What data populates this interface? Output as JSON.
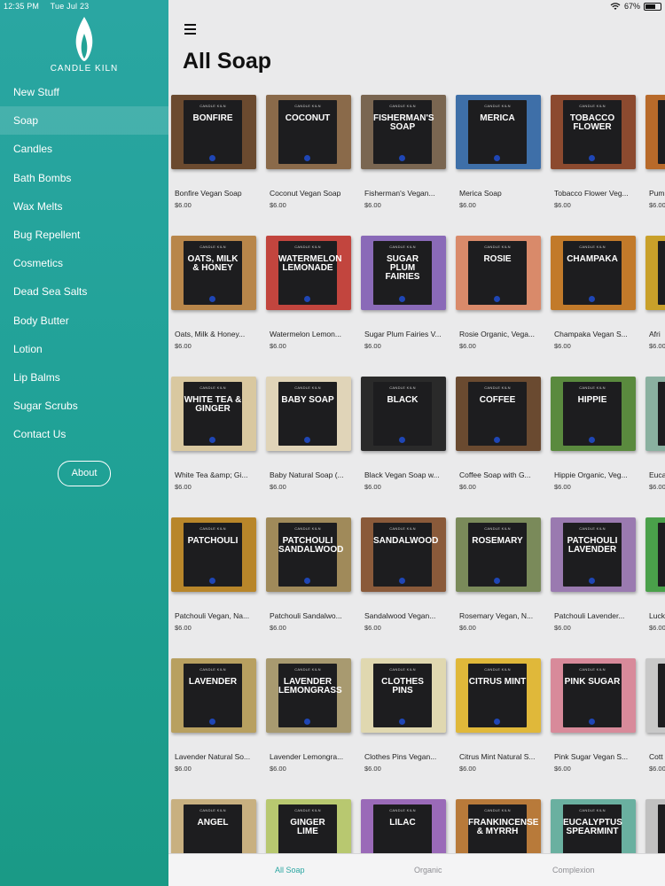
{
  "status": {
    "time": "12:35 PM",
    "date": "Tue Jul 23",
    "battery": "67%"
  },
  "brand": {
    "name": "CANDLE KILN"
  },
  "sidebar": {
    "items": [
      {
        "label": "New Stuff"
      },
      {
        "label": "Soap"
      },
      {
        "label": "Candles"
      },
      {
        "label": "Bath Bombs"
      },
      {
        "label": "Wax Melts"
      },
      {
        "label": "Bug Repellent"
      },
      {
        "label": "Cosmetics"
      },
      {
        "label": "Dead Sea Salts"
      },
      {
        "label": "Body Butter"
      },
      {
        "label": "Lotion"
      },
      {
        "label": "Lip Balms"
      },
      {
        "label": "Sugar Scrubs"
      },
      {
        "label": "Contact Us"
      }
    ],
    "active_index": 1,
    "about_label": "About"
  },
  "main": {
    "title": "All Soap"
  },
  "products": [
    {
      "title": "BONFIRE",
      "name": "Bonfire Vegan Soap",
      "price": "$6.00",
      "color": "#6b4a2f"
    },
    {
      "title": "COCONUT",
      "name": "Coconut Vegan Soap",
      "price": "$6.00",
      "color": "#8a6a4a"
    },
    {
      "title": "FISHERMAN'S SOAP",
      "name": "Fisherman's Vegan...",
      "price": "$6.00",
      "color": "#7a6651"
    },
    {
      "title": "MERICA",
      "name": "Merica Soap",
      "price": "$6.00",
      "color": "#3e6fa8"
    },
    {
      "title": "TOBACCO FLOWER",
      "name": "Tobacco Flower Veg...",
      "price": "$6.00",
      "color": "#8c4a2f"
    },
    {
      "title": "",
      "name": "Pum",
      "price": "$6.00",
      "color": "#b86a2a"
    },
    {
      "title": "OATS, MILK & HONEY",
      "name": "Oats, Milk & Honey...",
      "price": "$6.00",
      "color": "#b8864a"
    },
    {
      "title": "WATERMELON LEMONADE",
      "name": "Watermelon Lemon...",
      "price": "$6.00",
      "color": "#c2453e"
    },
    {
      "title": "SUGAR PLUM FAIRIES",
      "name": "Sugar Plum Fairies V...",
      "price": "$6.00",
      "color": "#8a6ab8"
    },
    {
      "title": "ROSIE",
      "name": "Rosie Organic, Vega...",
      "price": "$6.00",
      "color": "#d98a6a"
    },
    {
      "title": "CHAMPAKA",
      "name": "Champaka Vegan S...",
      "price": "$6.00",
      "color": "#c27a2a"
    },
    {
      "title": "",
      "name": "Afri",
      "price": "$6.00",
      "color": "#c9a02a"
    },
    {
      "title": "WHITE TEA & GINGER",
      "name": "White Tea &amp; Gi...",
      "price": "$6.00",
      "color": "#d9c8a0"
    },
    {
      "title": "BABY SOAP",
      "name": "Baby Natural Soap (...",
      "price": "$6.00",
      "color": "#e0d4b8"
    },
    {
      "title": "BLACK",
      "name": "Black Vegan Soap w...",
      "price": "$6.00",
      "color": "#2a2a2a"
    },
    {
      "title": "COFFEE",
      "name": "Coffee Soap with G...",
      "price": "$6.00",
      "color": "#6a4a30"
    },
    {
      "title": "HIPPIE",
      "name": "Hippie Organic, Veg...",
      "price": "$6.00",
      "color": "#5a8a3e"
    },
    {
      "title": "",
      "name": "Euca",
      "price": "$6.00",
      "color": "#8ab0a0"
    },
    {
      "title": "PATCHOULI",
      "name": "Patchouli Vegan, Na...",
      "price": "$6.00",
      "color": "#b8862a"
    },
    {
      "title": "PATCHOULI SANDALWOOD",
      "name": "Patchouli Sandalwo...",
      "price": "$6.00",
      "color": "#a08a5a"
    },
    {
      "title": "SANDALWOOD",
      "name": "Sandalwood Vegan...",
      "price": "$6.00",
      "color": "#8a5a3a"
    },
    {
      "title": "ROSEMARY",
      "name": "Rosemary Vegan, N...",
      "price": "$6.00",
      "color": "#7a8a5a"
    },
    {
      "title": "PATCHOULI LAVENDER",
      "name": "Patchouli Lavender...",
      "price": "$6.00",
      "color": "#9a7ab0"
    },
    {
      "title": "",
      "name": "Luck",
      "price": "$6.00",
      "color": "#4aa04a"
    },
    {
      "title": "LAVENDER",
      "name": "Lavender Natural So...",
      "price": "$6.00",
      "color": "#b8a060"
    },
    {
      "title": "LAVENDER LEMONGRASS",
      "name": "Lavender Lemongra...",
      "price": "$6.00",
      "color": "#a89a70"
    },
    {
      "title": "CLOTHES PINS",
      "name": "Clothes Pins Vegan...",
      "price": "$6.00",
      "color": "#e0d8b0"
    },
    {
      "title": "CITRUS MINT",
      "name": "Citrus Mint Natural S...",
      "price": "$6.00",
      "color": "#e0b83a"
    },
    {
      "title": "PINK SUGAR",
      "name": "Pink Sugar Vegan S...",
      "price": "$6.00",
      "color": "#d88a9a"
    },
    {
      "title": "",
      "name": "Cott",
      "price": "$6.00",
      "color": "#c8c8c8"
    },
    {
      "title": "ANGEL",
      "name": "",
      "price": "",
      "color": "#c8b080"
    },
    {
      "title": "GINGER LIME",
      "name": "",
      "price": "",
      "color": "#b8c870"
    },
    {
      "title": "LILAC",
      "name": "",
      "price": "",
      "color": "#9a6ab8"
    },
    {
      "title": "FRANKINCENSE & MYRRH",
      "name": "",
      "price": "",
      "color": "#b87a3a"
    },
    {
      "title": "EUCALYPTUS SPEARMINT",
      "name": "",
      "price": "",
      "color": "#6ab0a0"
    },
    {
      "title": "",
      "name": "",
      "price": "",
      "color": "#c0c0c0"
    }
  ],
  "tabs": [
    {
      "label": "All Soap"
    },
    {
      "label": "Organic"
    },
    {
      "label": "Complexion"
    }
  ],
  "colors": {
    "accent": "#2aa6a2",
    "sidebar": "#1fa195"
  }
}
